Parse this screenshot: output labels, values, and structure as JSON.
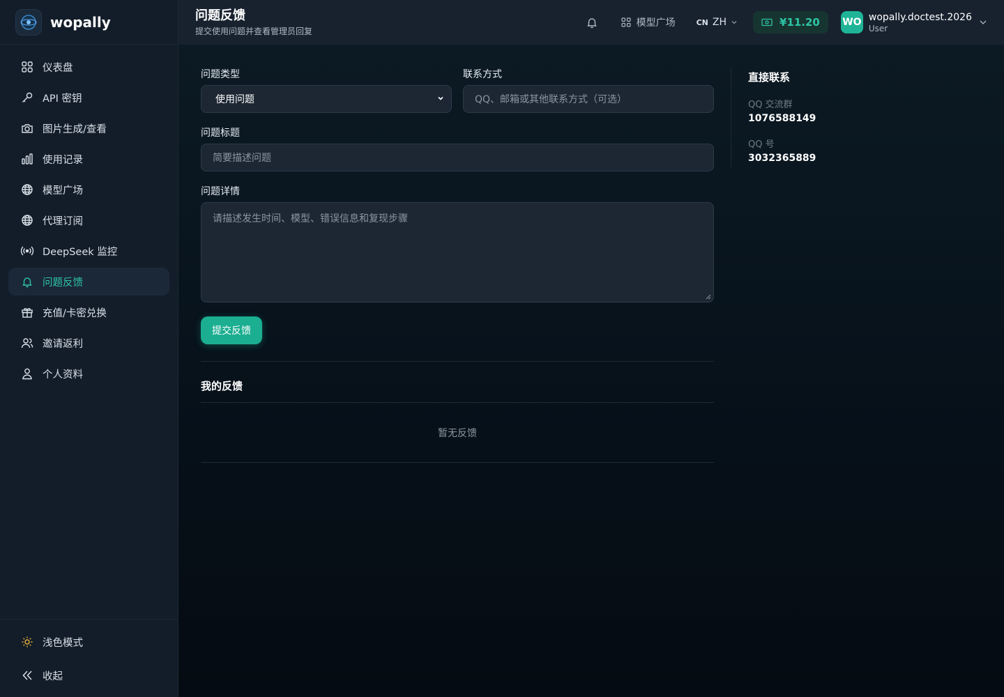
{
  "brand": {
    "name": "wopally"
  },
  "sidebar": {
    "items": [
      {
        "label": "仪表盘",
        "icon": "dashboard-icon"
      },
      {
        "label": "API 密钥",
        "icon": "key-icon"
      },
      {
        "label": "图片生成/查看",
        "icon": "camera-icon"
      },
      {
        "label": "使用记录",
        "icon": "bar-chart-icon"
      },
      {
        "label": "模型广场",
        "icon": "globe-icon"
      },
      {
        "label": "代理订阅",
        "icon": "globe-icon"
      },
      {
        "label": "DeepSeek 监控",
        "icon": "broadcast-icon"
      },
      {
        "label": "问题反馈",
        "icon": "bell-icon",
        "active": true
      },
      {
        "label": "充值/卡密兑换",
        "icon": "gift-icon"
      },
      {
        "label": "邀请返利",
        "icon": "users-icon"
      },
      {
        "label": "个人资料",
        "icon": "user-icon"
      }
    ],
    "bottom": {
      "theme_label": "浅色模式",
      "collapse_label": "收起"
    }
  },
  "header": {
    "title": "问题反馈",
    "subtitle": "提交使用问题并查看管理员回复",
    "market_label": "模型广场",
    "lang_flag": "CN",
    "lang_label": "ZH",
    "balance": "¥11.20",
    "user": {
      "avatar": "WO",
      "name": "wopally.doctest.2026",
      "role": "User"
    }
  },
  "form": {
    "type_label": "问题类型",
    "type_value": "使用问题",
    "contact_label": "联系方式",
    "contact_placeholder": "QQ、邮箱或其他联系方式（可选）",
    "title_label": "问题标题",
    "title_placeholder": "简要描述问题",
    "detail_label": "问题详情",
    "detail_placeholder": "请描述发生时间、模型、错误信息和复现步骤",
    "submit_label": "提交反馈"
  },
  "my_feedback": {
    "title": "我的反馈",
    "empty": "暂无反馈"
  },
  "contact": {
    "title": "直接联系",
    "group_label": "QQ 交流群",
    "group_value": "1076588149",
    "qq_label": "QQ 号",
    "qq_value": "3032365889"
  },
  "colors": {
    "accent": "#2ec4a6",
    "button": "#1bae91",
    "sidebar": "#131d29"
  }
}
